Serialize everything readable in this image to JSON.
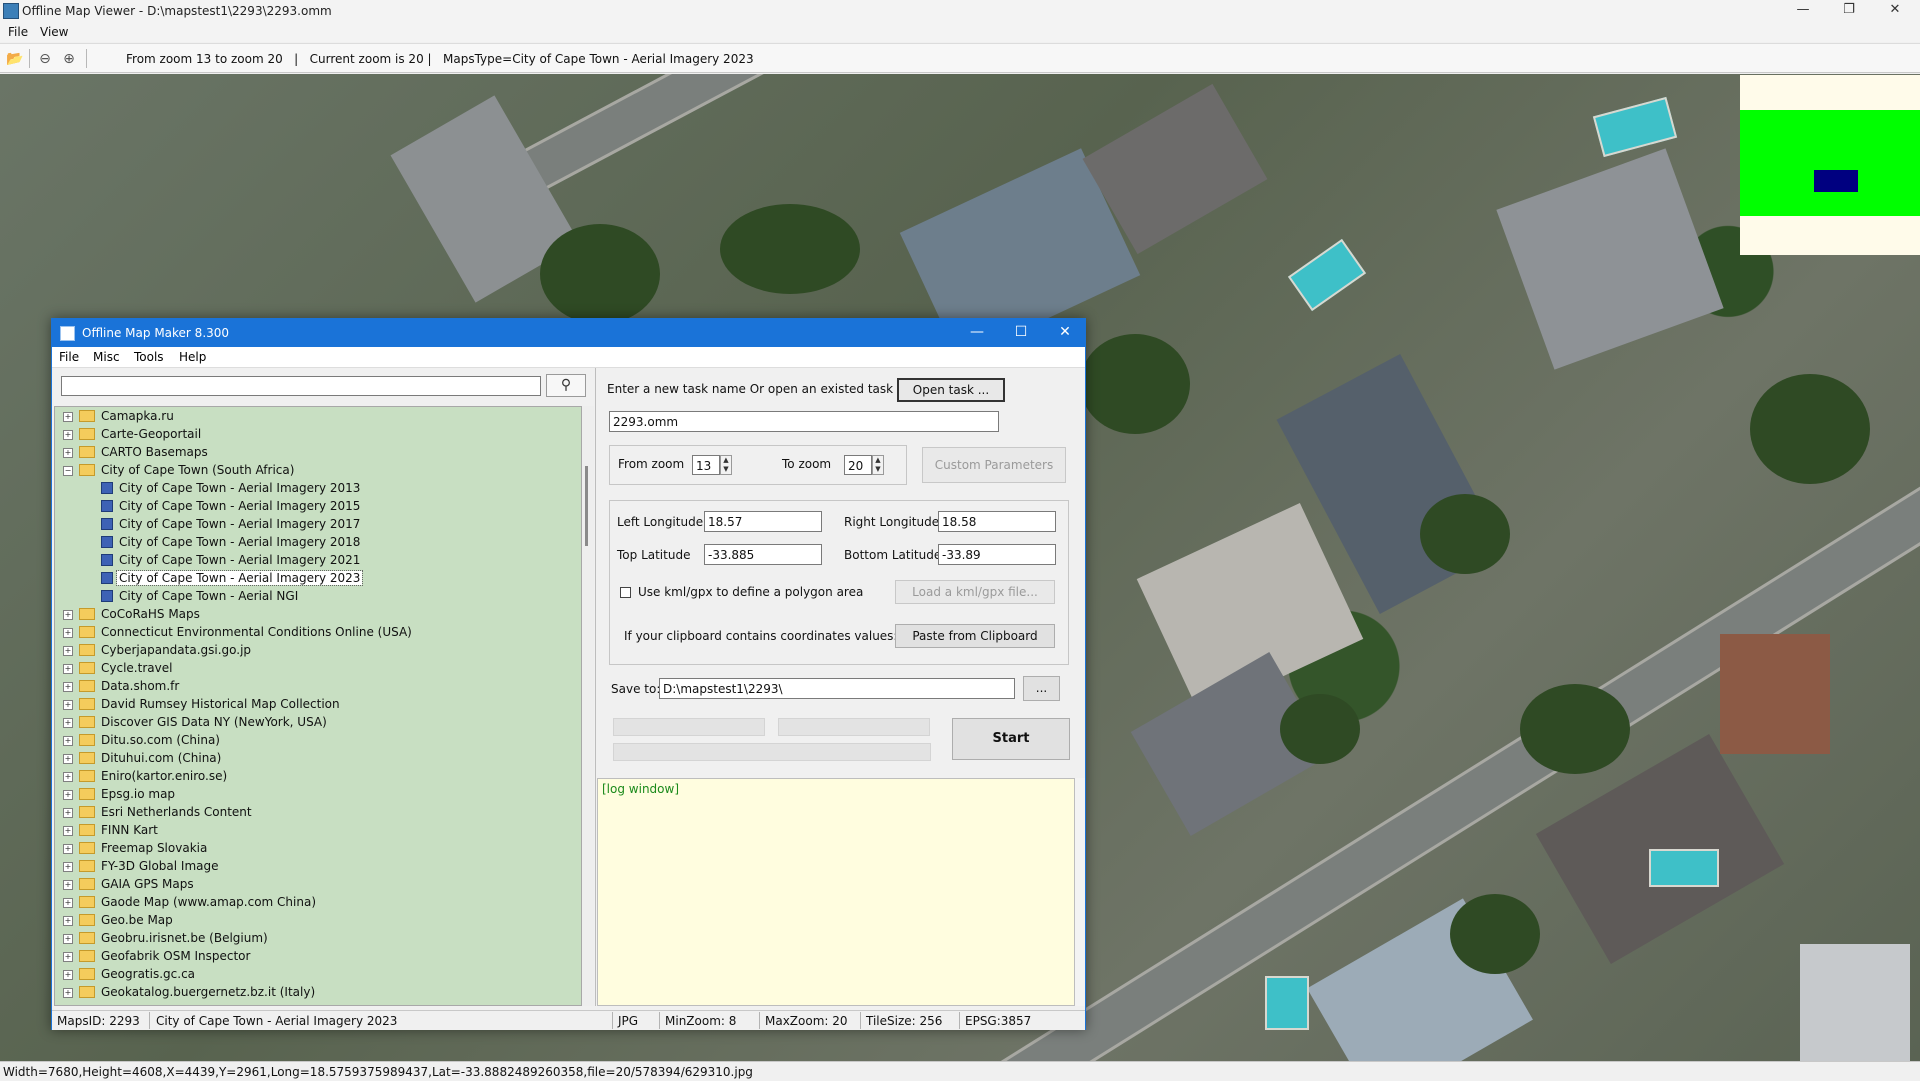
{
  "viewer": {
    "title": "Offline Map Viewer - D:\\mapstest1\\2293\\2293.omm",
    "menu": {
      "file": "File",
      "view": "View"
    },
    "toolbar": {
      "open_icon": "folder-open-icon",
      "zoom_out_icon": "zoom-out-icon",
      "zoom_in_icon": "zoom-in-icon",
      "info": "From zoom 13 to zoom 20   |   Current zoom is 20 |   MapsType=City of Cape Town - Aerial Imagery 2023"
    },
    "status": "Width=7680,Height=4608,X=4439,Y=2961,Long=18.5759375989437,Lat=-33.8882489260358,file=20/578394/629310.jpg"
  },
  "dialog": {
    "title": "Offline Map Maker 8.300",
    "menu": {
      "file": "File",
      "misc": "Misc",
      "tools": "Tools",
      "help": "Help"
    },
    "search": {
      "value": "",
      "icon": "search-icon"
    },
    "tree": [
      {
        "label": "Camapka.ru",
        "level": 0,
        "type": "folder",
        "expanded": false
      },
      {
        "label": "Carte-Geoportail",
        "level": 0,
        "type": "folder",
        "expanded": false
      },
      {
        "label": "CARTO Basemaps",
        "level": 0,
        "type": "folder",
        "expanded": false
      },
      {
        "label": "City of Cape Town (South Africa)",
        "level": 0,
        "type": "folder",
        "expanded": true
      },
      {
        "label": "City of Cape Town - Aerial Imagery 2013",
        "level": 1,
        "type": "map"
      },
      {
        "label": "City of Cape Town - Aerial Imagery 2015",
        "level": 1,
        "type": "map"
      },
      {
        "label": "City of Cape Town - Aerial Imagery 2017",
        "level": 1,
        "type": "map"
      },
      {
        "label": "City of Cape Town - Aerial Imagery 2018",
        "level": 1,
        "type": "map"
      },
      {
        "label": "City of Cape Town - Aerial Imagery 2021",
        "level": 1,
        "type": "map"
      },
      {
        "label": "City of Cape Town - Aerial Imagery 2023",
        "level": 1,
        "type": "map",
        "selected": true
      },
      {
        "label": "City of Cape Town - Aerial NGI",
        "level": 1,
        "type": "map"
      },
      {
        "label": "CoCoRaHS Maps",
        "level": 0,
        "type": "folder",
        "expanded": false
      },
      {
        "label": "Connecticut Environmental Conditions Online (USA)",
        "level": 0,
        "type": "folder",
        "expanded": false
      },
      {
        "label": "Cyberjapandata.gsi.go.jp",
        "level": 0,
        "type": "folder",
        "expanded": false
      },
      {
        "label": "Cycle.travel",
        "level": 0,
        "type": "folder",
        "expanded": false
      },
      {
        "label": "Data.shom.fr",
        "level": 0,
        "type": "folder",
        "expanded": false
      },
      {
        "label": "David Rumsey Historical Map Collection",
        "level": 0,
        "type": "folder",
        "expanded": false
      },
      {
        "label": "Discover GIS Data NY (NewYork, USA)",
        "level": 0,
        "type": "folder",
        "expanded": false
      },
      {
        "label": "Ditu.so.com (China)",
        "level": 0,
        "type": "folder",
        "expanded": false
      },
      {
        "label": "Dituhui.com (China)",
        "level": 0,
        "type": "folder",
        "expanded": false
      },
      {
        "label": "Eniro(kartor.eniro.se)",
        "level": 0,
        "type": "folder",
        "expanded": false
      },
      {
        "label": "Epsg.io map",
        "level": 0,
        "type": "folder",
        "expanded": false
      },
      {
        "label": "Esri Netherlands Content",
        "level": 0,
        "type": "folder",
        "expanded": false
      },
      {
        "label": "FINN Kart",
        "level": 0,
        "type": "folder",
        "expanded": false
      },
      {
        "label": "Freemap Slovakia",
        "level": 0,
        "type": "folder",
        "expanded": false
      },
      {
        "label": "FY-3D Global Image",
        "level": 0,
        "type": "folder",
        "expanded": false
      },
      {
        "label": "GAIA GPS Maps",
        "level": 0,
        "type": "folder",
        "expanded": false
      },
      {
        "label": "Gaode Map (www.amap.com China)",
        "level": 0,
        "type": "folder",
        "expanded": false
      },
      {
        "label": "Geo.be Map",
        "level": 0,
        "type": "folder",
        "expanded": false
      },
      {
        "label": "Geobru.irisnet.be (Belgium)",
        "level": 0,
        "type": "folder",
        "expanded": false
      },
      {
        "label": "Geofabrik OSM Inspector",
        "level": 0,
        "type": "folder",
        "expanded": false
      },
      {
        "label": "Geogratis.gc.ca",
        "level": 0,
        "type": "folder",
        "expanded": false
      },
      {
        "label": "Geokatalog.buergernetz.bz.it (Italy)",
        "level": 0,
        "type": "folder",
        "expanded": false
      }
    ],
    "task_prompt": "Enter a new task name Or open an existed task to continue:",
    "open_task": "Open task ...",
    "task_name": "2293.omm",
    "from_zoom_label": "From zoom",
    "from_zoom": "13",
    "to_zoom_label": "To zoom",
    "to_zoom": "20",
    "custom_params": "Custom Parameters",
    "left_lon_label": "Left Longitude",
    "left_lon": "18.57",
    "right_lon_label": "Right Longitude",
    "right_lon": "18.58",
    "top_lat_label": "Top Latitude",
    "top_lat": "-33.885",
    "bottom_lat_label": "Bottom Latitude",
    "bottom_lat": "-33.89",
    "kml_check_label": "Use kml/gpx to define a polygon area",
    "load_kml": "Load a kml/gpx file...",
    "clipboard_label": "If your clipboard contains coordinates values:",
    "paste": "Paste from Clipboard",
    "save_to_label": "Save to:",
    "save_to": "D:\\mapstest1\\2293\\",
    "browse": "...",
    "start": "Start",
    "log": "[log window]",
    "status": {
      "maps_id": "MapsID: 2293",
      "map_name": "City of Cape Town - Aerial Imagery 2023",
      "format": "JPG",
      "min_zoom": "MinZoom: 8",
      "max_zoom": "MaxZoom: 20",
      "tile_size": "TileSize: 256",
      "epsg": "EPSG:3857"
    }
  },
  "colors": {
    "dialog_title": "#1a73d8",
    "tree_bg": "#c8dfc2",
    "log_bg": "#fffddf",
    "overview_green": "#00ff00",
    "overview_box": "#000080"
  }
}
